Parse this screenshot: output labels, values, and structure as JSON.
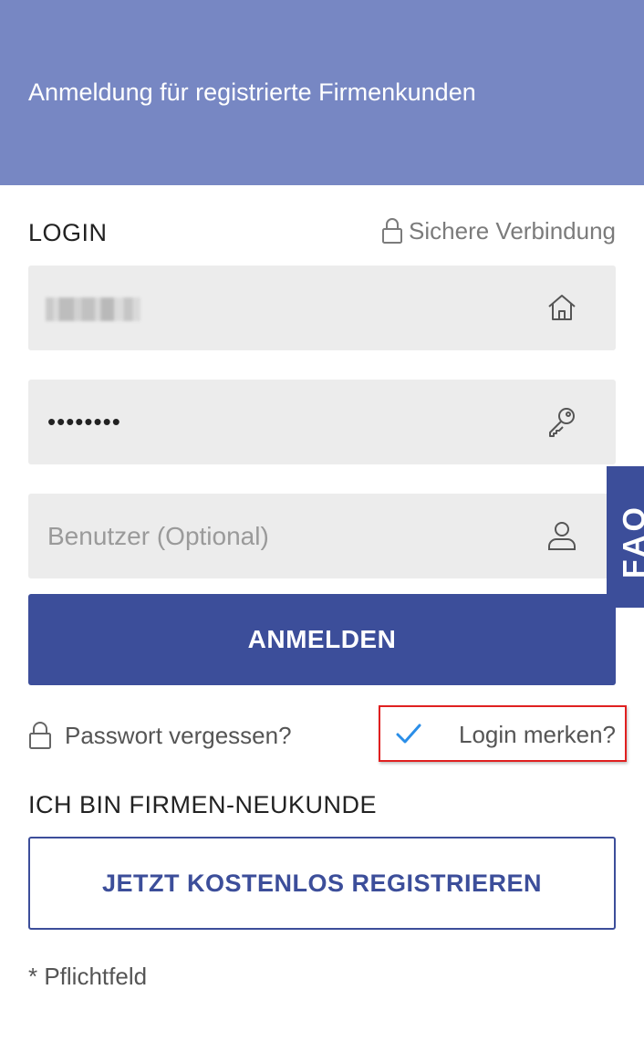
{
  "header": {
    "title": "Anmeldung für registrierte Firmenkunden"
  },
  "login": {
    "title": "LOGIN",
    "secure_label": "Sichere Verbindung",
    "username": {
      "value": "",
      "icon": "home-icon"
    },
    "password": {
      "value": "••••••••",
      "icon": "key-icon"
    },
    "user": {
      "placeholder": "Benutzer (Optional)",
      "icon": "user-icon"
    },
    "submit_label": "ANMELDEN",
    "forgot_label": "Passwort vergessen?",
    "remember_label": "Login merken?",
    "remember_checked": true
  },
  "faq": {
    "label": "FAQ"
  },
  "register": {
    "title": "ICH BIN FIRMEN-NEUKUNDE",
    "button_label": "JETZT KOSTENLOS REGISTRIEREN"
  },
  "footer": {
    "required_note": "* Pflichtfeld"
  },
  "colors": {
    "header_bg": "#7787c3",
    "primary": "#3c4e9a",
    "field_bg": "#ececec",
    "highlight_border": "#e02020",
    "check": "#2a8ee8"
  }
}
